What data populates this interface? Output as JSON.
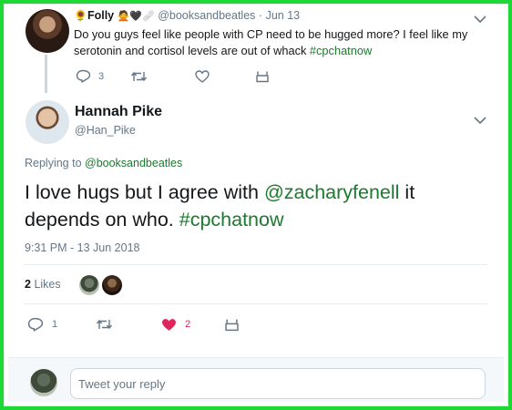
{
  "parent_tweet": {
    "name": "Folly",
    "handle": "@booksandbeatles",
    "date": "Jun 13",
    "text_before": "Do you guys feel like people with CP need to be hugged more? I feel like my serotonin and cortisol levels are out of whack ",
    "hashtag": "#cpchatnow",
    "reply_count": "3",
    "avatar_icon": "user-photo-icon",
    "name_emojis": [
      "sunflower-icon",
      "woman-gesturing-icon",
      "black-heart-icon",
      "bandage-icon"
    ]
  },
  "main_tweet": {
    "name": "Hannah Pike",
    "handle": "@Han_Pike",
    "replying_label": "Replying to ",
    "replying_handle": "@booksandbeatles",
    "text_1": "I love hugs but I agree with ",
    "mention": "@zacharyfenell",
    "text_2": " it depends on who. ",
    "hashtag": "#cpchatnow",
    "timestamp": "9:31 PM - 13 Jun 2018",
    "likes_count": "2",
    "likes_label": "Likes",
    "reply_count": "1",
    "like_count": "2"
  },
  "reply_box": {
    "placeholder": "Tweet your reply"
  },
  "colors": {
    "frame_border": "#1ed836",
    "link": "#1b7a2e",
    "muted": "#657786",
    "liked_heart": "#e0245e"
  }
}
